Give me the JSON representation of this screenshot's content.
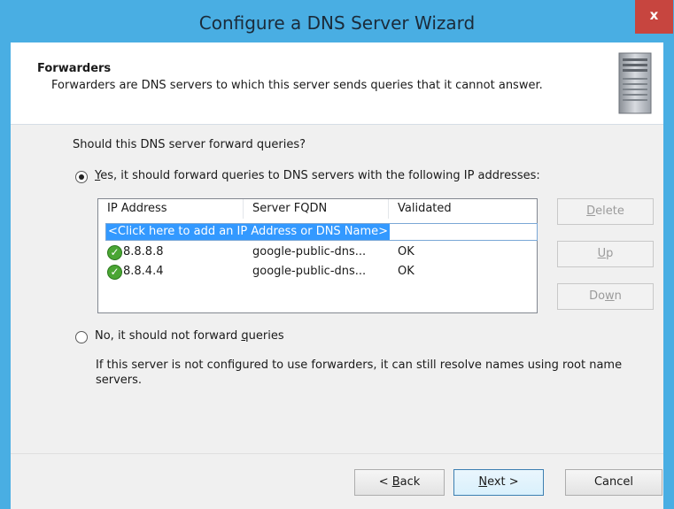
{
  "window": {
    "title": "Configure a DNS Server Wizard",
    "close_label": "x"
  },
  "header": {
    "title": "Forwarders",
    "description": "Forwarders are DNS servers to which this server sends queries that it cannot answer.",
    "icon": "server-icon"
  },
  "question": "Should this DNS server forward queries?",
  "option_yes": {
    "prefix": "",
    "mnemonic": "Y",
    "rest": "es, it should forward queries to DNS servers with the following IP addresses:",
    "selected": true
  },
  "table": {
    "columns": [
      "IP Address",
      "Server FQDN",
      "Validated"
    ],
    "add_row": "<Click here to add an IP Address or DNS Name>",
    "rows": [
      {
        "ip": "8.8.8.8",
        "fqdn": "google-public-dns...",
        "validated": "OK",
        "icon": "check-circle-icon"
      },
      {
        "ip": "8.8.4.4",
        "fqdn": "google-public-dns...",
        "validated": "OK",
        "icon": "check-circle-icon"
      }
    ]
  },
  "side_buttons": {
    "delete": {
      "mnemonic": "D",
      "rest": "elete"
    },
    "up": {
      "mnemonic": "U",
      "rest": "p"
    },
    "down": {
      "prefix": "Do",
      "mnemonic": "w",
      "rest": "n"
    }
  },
  "option_no": {
    "prefix": "No, it should not forward ",
    "mnemonic": "q",
    "rest": "ueries",
    "selected": false
  },
  "info": "If this server is not configured to use forwarders, it can still resolve names using root name servers.",
  "footer": {
    "back": {
      "prefix": "< ",
      "mnemonic": "B",
      "rest": "ack"
    },
    "next": {
      "mnemonic": "N",
      "rest": "ext >"
    },
    "cancel": "Cancel"
  },
  "colors": {
    "frame": "#49aee3",
    "selection": "#3399ff",
    "ok_green": "#4aa533",
    "close_red": "#c7453f"
  }
}
